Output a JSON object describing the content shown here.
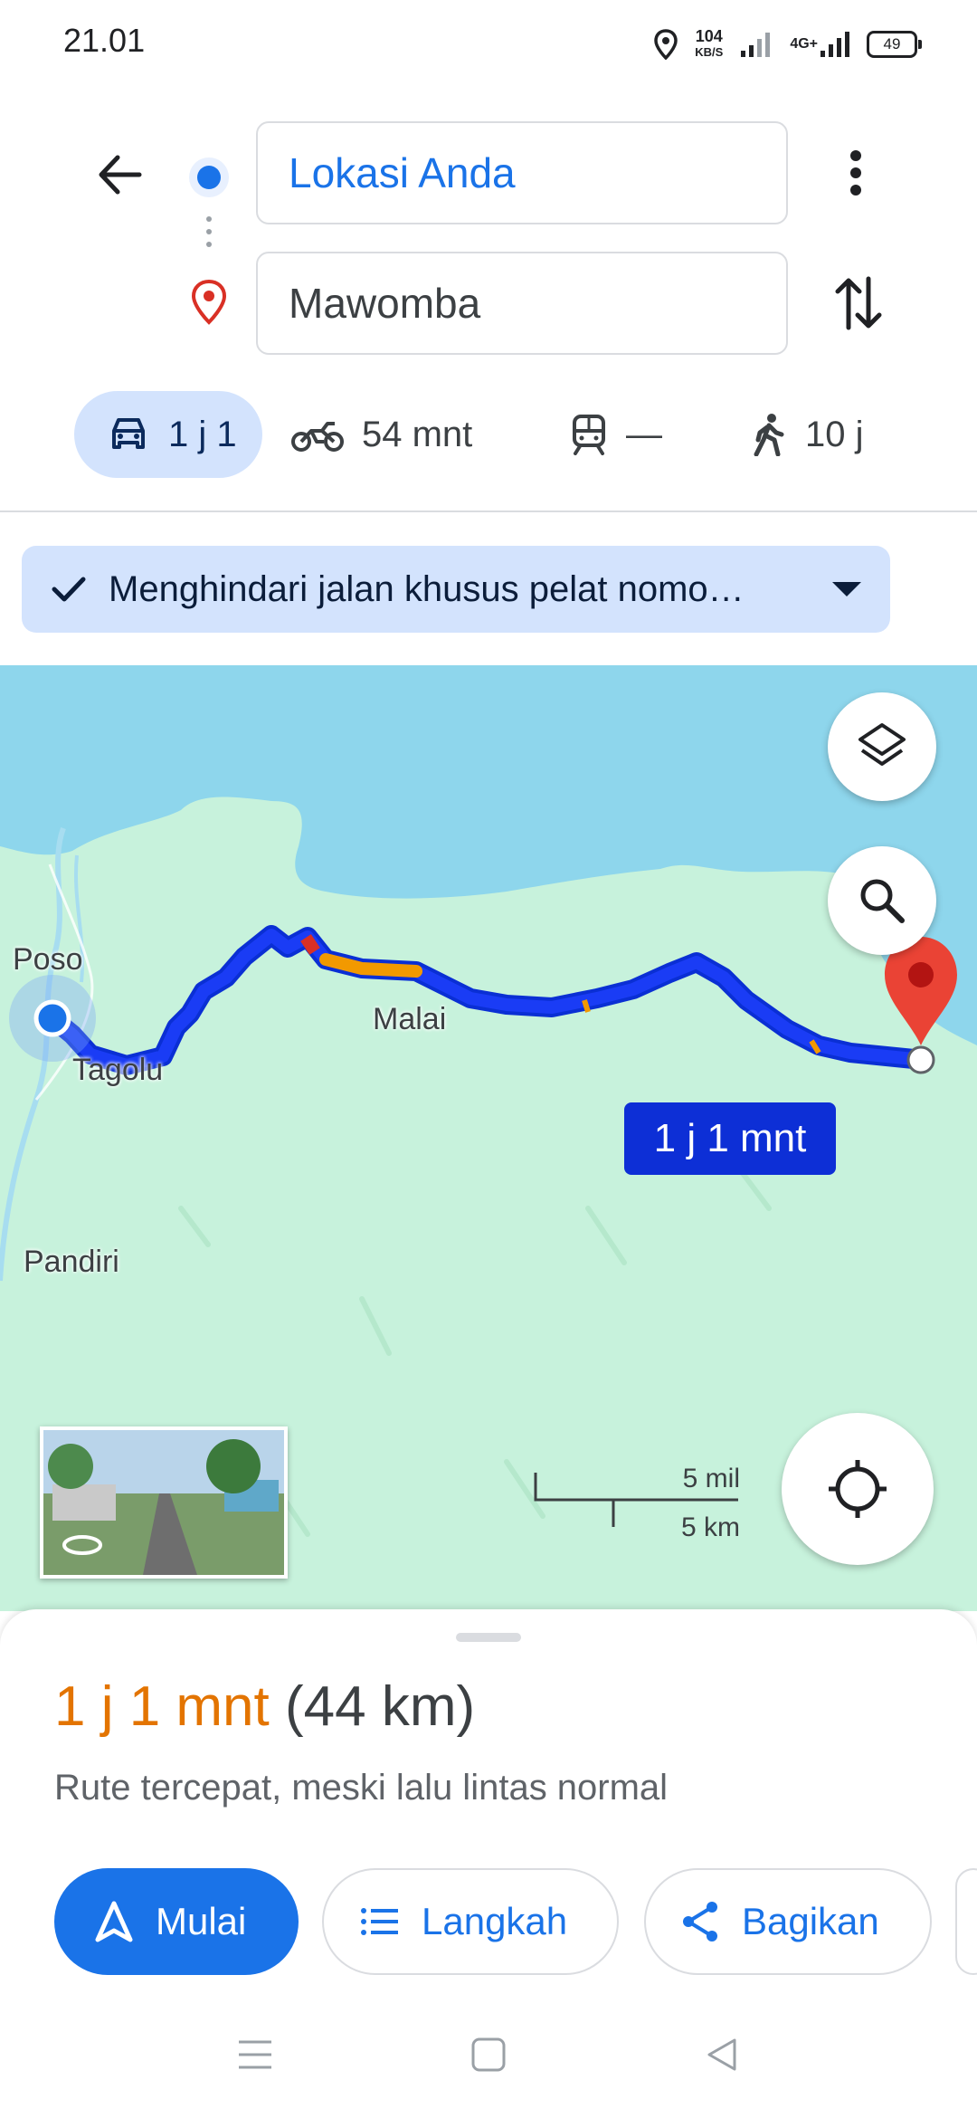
{
  "status_bar": {
    "time": "21.01",
    "net_speed_value": "104",
    "net_speed_unit": "KB/S",
    "network": "4G+",
    "battery": "49"
  },
  "header": {
    "origin": "Lokasi Anda",
    "destination": "Mawomba"
  },
  "modes": [
    {
      "icon": "car-icon",
      "label": "1 j 1",
      "active": true
    },
    {
      "icon": "motorcycle-icon",
      "label": "54 mnt"
    },
    {
      "icon": "transit-icon",
      "label": "—"
    },
    {
      "icon": "walk-icon",
      "label": "10 j"
    }
  ],
  "filter_chip": {
    "label": "Menghindari jalan khusus pelat nomo…"
  },
  "map": {
    "labels": {
      "poso": "Poso",
      "tagolu": "Tagolu",
      "malai": "Malai",
      "pandiri": "Pandiri"
    },
    "eta_bubble": "1 j 1 mnt",
    "scale": {
      "imperial": "5 mil",
      "metric": "5 km"
    },
    "colors": {
      "route": "#1a3cf5",
      "traffic_slow": "#f29900",
      "traffic_jam": "#d93025",
      "water": "#8ed6ec",
      "land": "#c7f2dc"
    }
  },
  "sheet": {
    "eta": "1 j 1 mnt",
    "distance": "(44 km)",
    "description": "Rute tercepat, meski lalu lintas normal",
    "buttons": {
      "start": "Mulai",
      "steps": "Langkah",
      "share": "Bagikan"
    }
  }
}
